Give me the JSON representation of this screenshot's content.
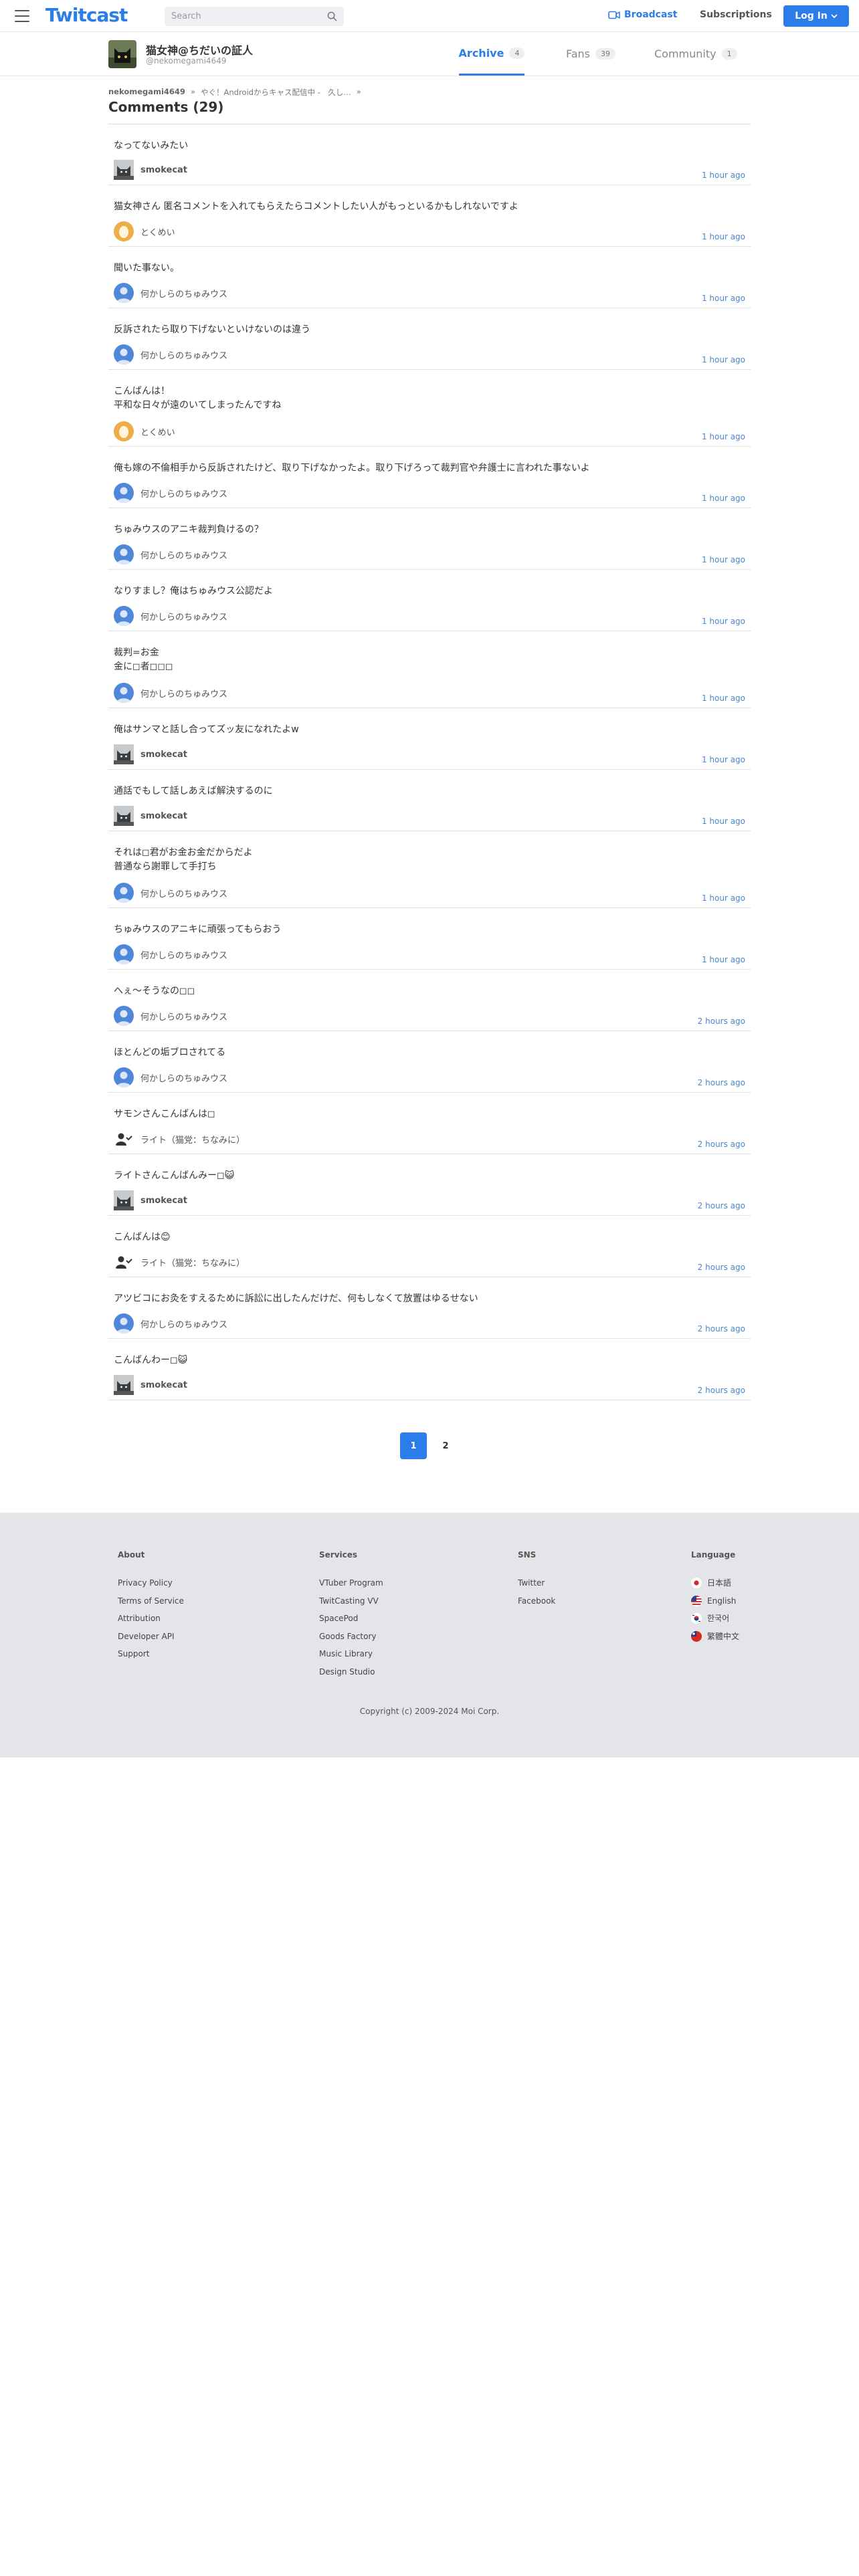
{
  "header": {
    "logo": "Twitcast",
    "search_placeholder": "Search",
    "broadcast": "Broadcast",
    "subscriptions": "Subscriptions",
    "login": "Log In"
  },
  "profile": {
    "name": "猫女神@ちだいの証人",
    "handle": "@nekomegami4649",
    "tabs": [
      {
        "label": "Archive",
        "count": "4"
      },
      {
        "label": "Fans",
        "count": "39"
      },
      {
        "label": "Community",
        "count": "1"
      }
    ]
  },
  "breadcrumb": [
    "nekomegami4649",
    "»",
    "やぐ！Androidからキャス配信中 -　久し…",
    "»"
  ],
  "page_title": "Comments (29)",
  "comments": [
    {
      "text": "なってないみたい",
      "user": "smokecat",
      "time": "1 hour ago",
      "avatar": "cat-avatar"
    },
    {
      "text": "猫女神さん 匿名コメントを入れてもらえたらコメントしたい人がもっといるかもしれないですよ",
      "user": "とくめい",
      "time": "1 hour ago",
      "avatar": "egg-avatar"
    },
    {
      "text": "聞いた事ない。",
      "user": "何かしらのちゅみウス",
      "time": "1 hour ago",
      "avatar": "default-avatar"
    },
    {
      "text": "反訴されたら取り下げないといけないのは違う",
      "user": "何かしらのちゅみウス",
      "time": "1 hour ago",
      "avatar": "default-avatar"
    },
    {
      "text": "こんばんは！\n平和な日々が遠のいてしまったんですね",
      "user": "とくめい",
      "time": "1 hour ago",
      "avatar": "egg-avatar"
    },
    {
      "text": "俺も嫁の不倫相手から反訴されたけど、取り下げなかったよ。取り下げろって裁判官や弁護士に言われた事ないよ",
      "user": "何かしらのちゅみウス",
      "time": "1 hour ago",
      "avatar": "default-avatar"
    },
    {
      "text": "ちゅみウスのアニキ裁判負けるの？",
      "user": "何かしらのちゅみウス",
      "time": "1 hour ago",
      "avatar": "default-avatar"
    },
    {
      "text": "なりすまし？俺はちゅみウス公認だよ",
      "user": "何かしらのちゅみウス",
      "time": "1 hour ago",
      "avatar": "default-avatar"
    },
    {
      "text": "裁判=お金\n金に◻︎者◻︎◻︎◻︎",
      "user": "何かしらのちゅみウス",
      "time": "1 hour ago",
      "avatar": "default-avatar"
    },
    {
      "text": "俺はサンマと話し合ってズッ友になれたよw",
      "user": "smokecat",
      "time": "1 hour ago",
      "avatar": "cat-avatar"
    },
    {
      "text": "通話でもして話しあえば解決するのに",
      "user": "smokecat",
      "time": "1 hour ago",
      "avatar": "cat-avatar"
    },
    {
      "text": "それは◻︎君がお金お金だからだよ\n普通なら謝罪して手打ち",
      "user": "何かしらのちゅみウス",
      "time": "1 hour ago",
      "avatar": "default-avatar"
    },
    {
      "text": "ちゅみウスのアニキに頑張ってもらおう",
      "user": "何かしらのちゅみウス",
      "time": "1 hour ago",
      "avatar": "default-avatar"
    },
    {
      "text": "へぇ〜そうなの◻︎◻︎",
      "user": "何かしらのちゅみウス",
      "time": "2 hours ago",
      "avatar": "default-avatar"
    },
    {
      "text": "ほとんどの垢ブロされてる",
      "user": "何かしらのちゅみウス",
      "time": "2 hours ago",
      "avatar": "default-avatar"
    },
    {
      "text": "サモンさんこんばんは◻︎",
      "user": "ライト（猫党：ちなみに）",
      "time": "2 hours ago",
      "avatar": "people-avatar"
    },
    {
      "text": "ライトさんこんばんみー◻︎😺",
      "user": "smokecat",
      "time": "2 hours ago",
      "avatar": "cat-avatar"
    },
    {
      "text": "こんばんは😊",
      "user": "ライト（猫党：ちなみに）",
      "time": "2 hours ago",
      "avatar": "people-avatar"
    },
    {
      "text": "アツビコにお灸をすえるために訴訟に出したんだけだ、何もしなくて放置はゆるせない",
      "user": "何かしらのちゅみウス",
      "time": "2 hours ago",
      "avatar": "default-avatar"
    },
    {
      "text": "こんばんわー◻︎😺",
      "user": "smokecat",
      "time": "2 hours ago",
      "avatar": "cat-avatar"
    }
  ],
  "pagination": [
    "1",
    "2"
  ],
  "footer": {
    "columns": [
      {
        "title": "About",
        "links": [
          "Privacy Policy",
          "Terms of Service",
          "Attribution",
          "Developer API",
          "Support"
        ]
      },
      {
        "title": "Services",
        "links": [
          "VTuber Program",
          "TwitCasting VV",
          "SpacePod",
          "Goods Factory",
          "Music Library",
          "Design Studio"
        ]
      },
      {
        "title": "SNS",
        "links": [
          "Twitter",
          "Facebook"
        ]
      }
    ],
    "language_title": "Language",
    "languages": [
      "日本語",
      "English",
      "한국어",
      "繁體中文"
    ],
    "copyright": "Copyright (c) 2009-2024 Moi Corp."
  },
  "colors": {
    "accent": "#2b7de9",
    "time": "#4a86c8",
    "footer_bg": "#e3e5e8"
  }
}
